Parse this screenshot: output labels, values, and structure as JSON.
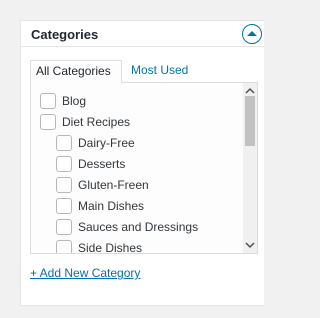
{
  "panel": {
    "title": "Categories",
    "toggle_icon": "chevron-up-icon"
  },
  "tabs": [
    {
      "label": "All Categories",
      "active": true
    },
    {
      "label": "Most Used",
      "active": false
    }
  ],
  "categories": [
    {
      "label": "Blog",
      "checked": false,
      "level": 0
    },
    {
      "label": "Diet Recipes",
      "checked": false,
      "level": 0
    },
    {
      "label": "Dairy-Free",
      "checked": false,
      "level": 1
    },
    {
      "label": "Desserts",
      "checked": false,
      "level": 1
    },
    {
      "label": "Gluten-Freen",
      "checked": false,
      "level": 1
    },
    {
      "label": "Main Dishes",
      "checked": false,
      "level": 1
    },
    {
      "label": "Sauces and Dressings",
      "checked": false,
      "level": 1
    },
    {
      "label": "Side Dishes",
      "checked": false,
      "level": 1
    }
  ],
  "add_link": "+ Add New Category",
  "colors": {
    "accent": "#0073aa",
    "panel_border": "#e5e5e5",
    "checkbox_border": "#b4b9be",
    "page_background": "#f1f1f1"
  }
}
